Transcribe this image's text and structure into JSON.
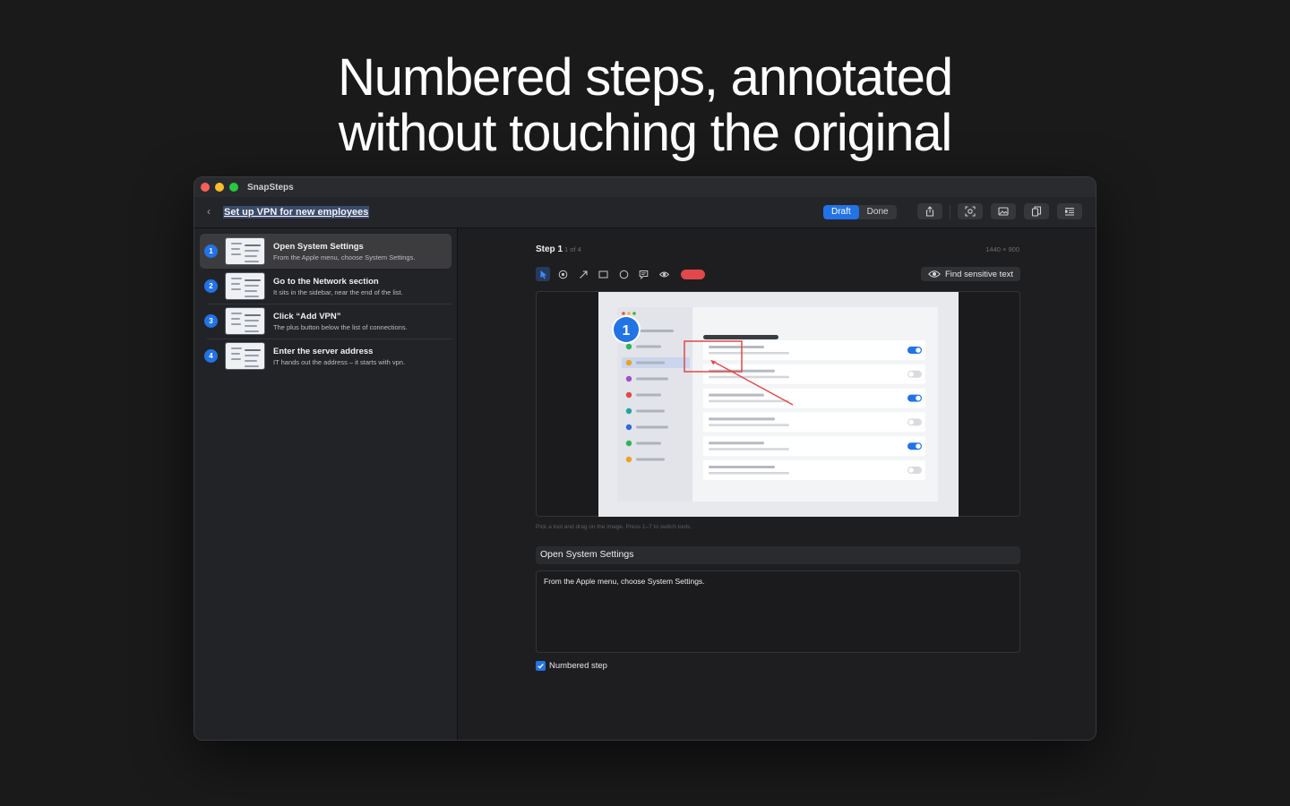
{
  "headline": {
    "line1": "Numbered steps, annotated",
    "line2": "without touching the original"
  },
  "window": {
    "app_name": "SnapSteps",
    "document_title": "Set up VPN for new employees",
    "status_segment": {
      "draft": "Draft",
      "done": "Done",
      "selected": "Draft"
    },
    "toolbar_icons": [
      "share-icon",
      "capture-icon",
      "image-icon",
      "copy-icon",
      "inspector-icon"
    ]
  },
  "sidebar": {
    "steps": [
      {
        "number": "1",
        "title": "Open System Settings",
        "description": "From the Apple menu, choose System Settings.",
        "selected": true
      },
      {
        "number": "2",
        "title": "Go to the Network section",
        "description": "It sits in the sidebar, near the end of the list.",
        "selected": false
      },
      {
        "number": "3",
        "title": "Click “Add VPN”",
        "description": "The plus button below the list of connections.",
        "selected": false
      },
      {
        "number": "4",
        "title": "Enter the server address",
        "description": "IT hands out the address – it starts with vpn.",
        "selected": false
      }
    ]
  },
  "editor": {
    "step_label": "Step 1",
    "step_count": "1 of 4",
    "dimensions": "1440 × 900",
    "tools": [
      "pointer-icon",
      "numbered-marker-icon",
      "arrow-icon",
      "rectangle-icon",
      "ellipse-icon",
      "callout-icon",
      "blur-icon"
    ],
    "active_tool": "pointer-icon",
    "annotation_color": "#e0484a",
    "find_sensitive_label": "Find sensitive text",
    "screenshot": {
      "marker_number": "1",
      "toggles_on": [
        true,
        false,
        true,
        false,
        true,
        false
      ],
      "sidebar_dot_colors": [
        "#2fb35c",
        "#f0a020",
        "#a050c8",
        "#e04848",
        "#1fa8a0",
        "#3068e0",
        "#2fb35c",
        "#f0a020"
      ]
    },
    "hint": "Pick a tool and drag on the image. Press 1–7 to switch tools.",
    "title_value": "Open System Settings",
    "description_value": "From the Apple menu, choose System Settings.",
    "numbered_step_label": "Numbered step",
    "numbered_step_checked": true
  },
  "colors": {
    "accent": "#2273e6",
    "background": "#1a1a1b",
    "annotation_red": "#e0484a"
  }
}
